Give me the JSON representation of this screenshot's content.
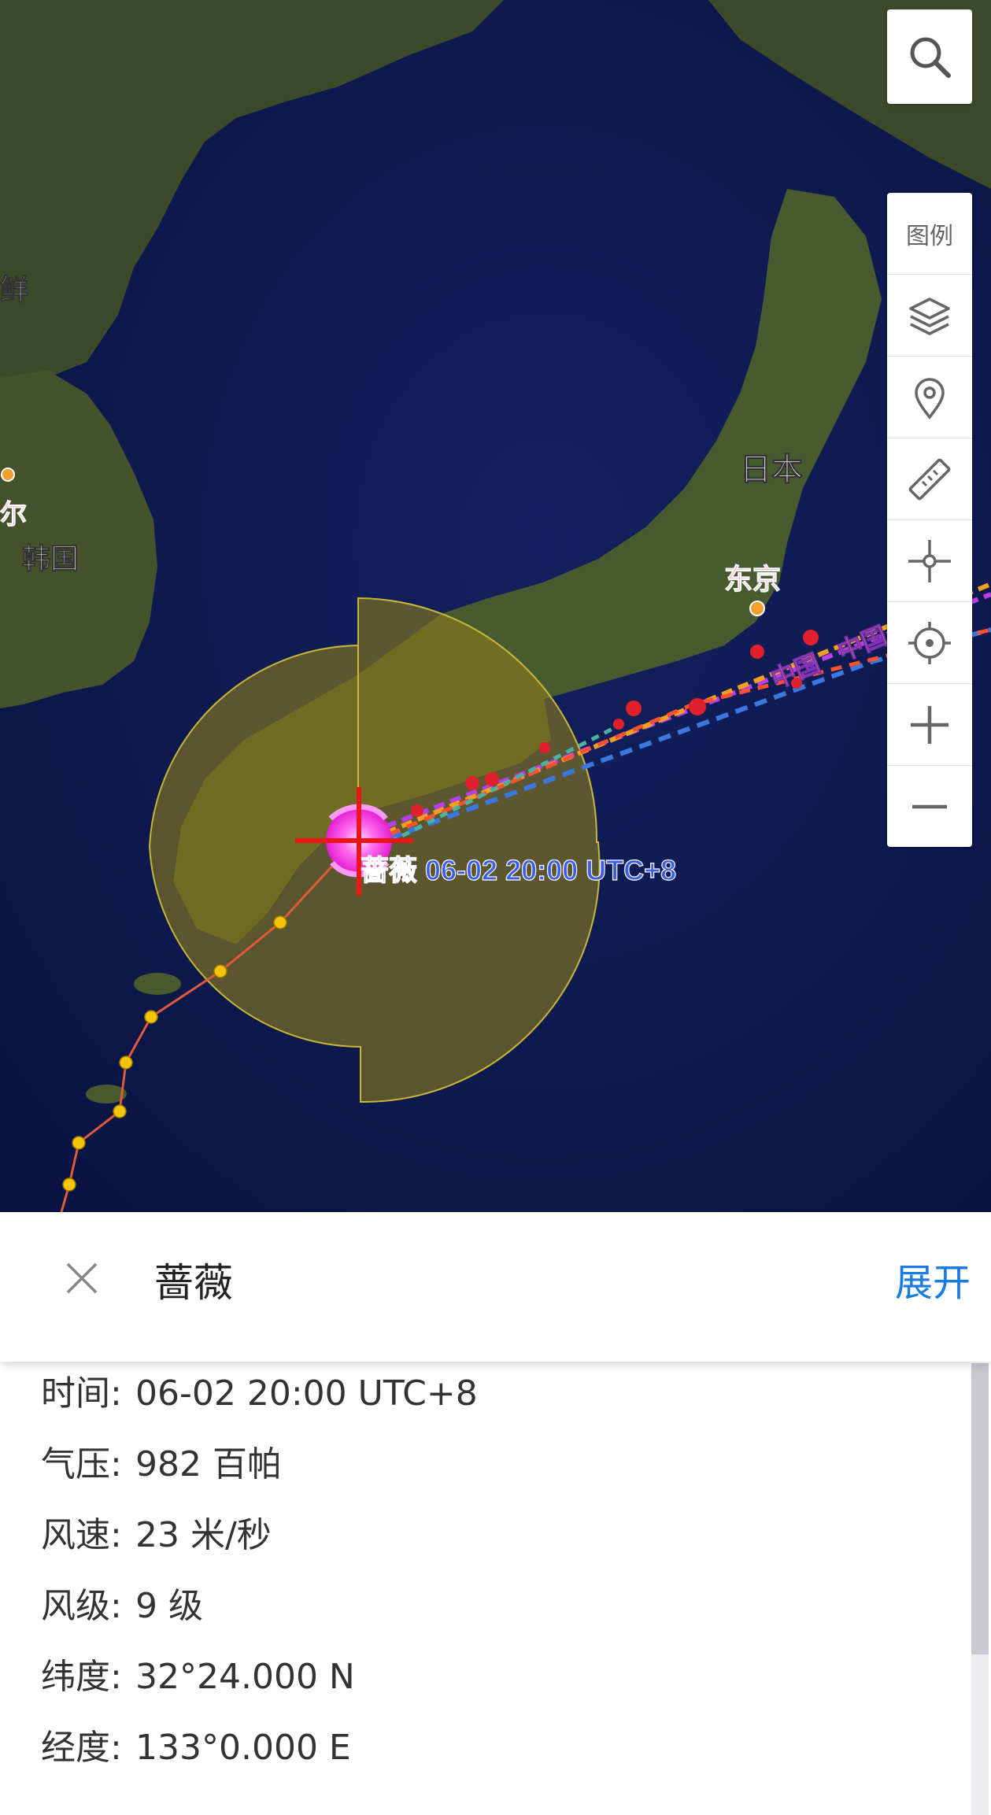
{
  "map": {
    "place_labels": [
      "日本",
      "东京",
      "韩国",
      "鲜",
      "尔"
    ],
    "track_labels": [
      "中国",
      "中国"
    ],
    "storm_label": "蔷薇 06-02 20:00 UTC+8"
  },
  "controls": {
    "search_icon": "search-icon",
    "legend_label": "图例",
    "buttons": [
      "layers-icon",
      "location-pin-icon",
      "ruler-icon",
      "crosshair-icon",
      "locate-icon",
      "zoom-in-icon",
      "zoom-out-icon"
    ]
  },
  "sheet": {
    "close_icon": "close-icon",
    "title": "蔷薇",
    "expand_label": "展开"
  },
  "details": [
    {
      "key": "时间:",
      "value": "06-02 20:00 UTC+8"
    },
    {
      "key": "气压:",
      "value": "982 百帕"
    },
    {
      "key": "风速:",
      "value": "23 米/秒"
    },
    {
      "key": "风级:",
      "value": "9 级"
    },
    {
      "key": "纬度:",
      "value": "32°24.000 N"
    },
    {
      "key": "经度:",
      "value": "133°0.000 E"
    }
  ],
  "colors": {
    "accent": "#1a7be6",
    "sea": "#0c1a52",
    "land": "#3f4e2a",
    "wind_circle": "#8a7a1c",
    "past_track": "#e05a3a",
    "past_points": "#f2c40a",
    "forecast_points": "#e0202c"
  }
}
